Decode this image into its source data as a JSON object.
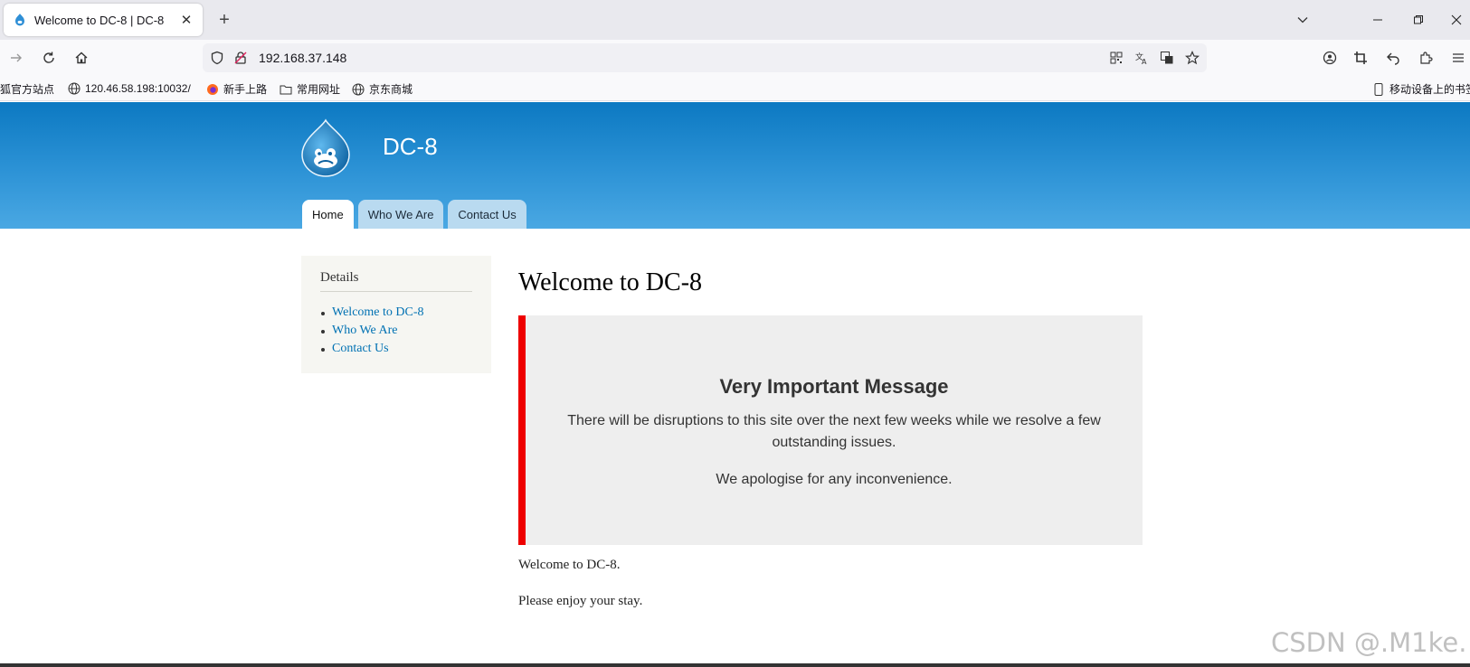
{
  "browser": {
    "tab": {
      "title": "Welcome to DC-8 | DC-8",
      "close": "✕"
    },
    "new_tab": "+",
    "address": "192.168.37.148",
    "bookmarks": [
      {
        "label": "火狐官方站点",
        "icon": "firefox-icon"
      },
      {
        "label": "120.46.58.198:10032/",
        "icon": "globe-icon"
      },
      {
        "label": "新手上路",
        "icon": "firefox-icon"
      },
      {
        "label": "常用网址",
        "icon": "folder-icon"
      },
      {
        "label": "京东商城",
        "icon": "globe-icon"
      }
    ],
    "mobile_bookmarks": "移动设备上的书签"
  },
  "site": {
    "name": "DC-8",
    "tabs": [
      {
        "label": "Home",
        "active": true
      },
      {
        "label": "Who We Are",
        "active": false
      },
      {
        "label": "Contact Us",
        "active": false
      }
    ],
    "sidebar": {
      "title": "Details",
      "links": [
        "Welcome to DC-8",
        "Who We Are",
        "Contact Us"
      ]
    },
    "page_title": "Welcome to DC-8",
    "message": {
      "heading": "Very Important Message",
      "line1": "There will be disruptions to this site over the next few weeks while we resolve a few outstanding issues.",
      "line2": "We apologise for any inconvenience."
    },
    "body": [
      "Welcome to DC-8.",
      "Please enjoy your stay."
    ]
  },
  "watermark": "CSDN @.M1ke.",
  "colors": {
    "header_top": "#0c79c2",
    "header_bottom": "#4aa8e3",
    "alert_border": "#ee0000",
    "link": "#0071b3"
  }
}
